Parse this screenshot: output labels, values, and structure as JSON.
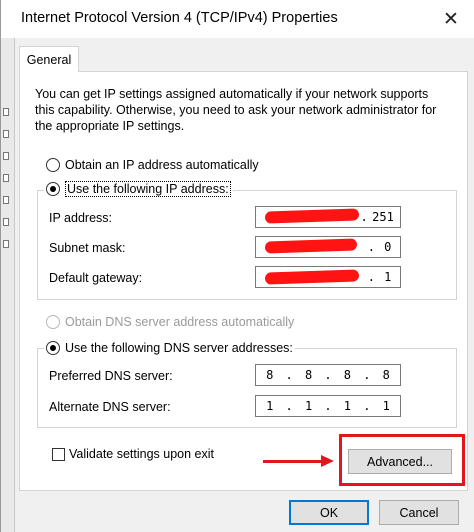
{
  "window": {
    "title": "Internet Protocol Version 4 (TCP/IPv4) Properties",
    "close_glyph": "✕"
  },
  "tabs": [
    {
      "label": "General"
    }
  ],
  "description": "You can get IP settings assigned automatically if your network supports this capability. Otherwise, you need to ask your network administrator for the appropriate IP settings.",
  "ip_mode": {
    "auto_label": "Obtain an IP address automatically",
    "manual_label": "Use the following IP address:",
    "selected": "manual"
  },
  "ip_fields": {
    "ip_address": {
      "label": "IP address:",
      "last_octet": "251"
    },
    "subnet_mask": {
      "label": "Subnet mask:",
      "last_octet": "0"
    },
    "default_gateway": {
      "label": "Default gateway:",
      "last_octet": "1"
    }
  },
  "dns_mode": {
    "auto_label": "Obtain DNS server address automatically",
    "manual_label": "Use the following DNS server addresses:",
    "selected": "manual"
  },
  "dns_fields": {
    "preferred": {
      "label": "Preferred DNS server:",
      "octets": [
        "8",
        "8",
        "8",
        "8"
      ]
    },
    "alternate": {
      "label": "Alternate DNS server:",
      "octets": [
        "1",
        "1",
        "1",
        "1"
      ]
    }
  },
  "validate": {
    "label": "Validate settings upon exit",
    "checked": false
  },
  "buttons": {
    "advanced": "Advanced...",
    "ok": "OK",
    "cancel": "Cancel"
  },
  "colors": {
    "annotation_red": "#e2171e",
    "redaction_red": "#ff1313",
    "focus_blue": "#0078d7"
  }
}
